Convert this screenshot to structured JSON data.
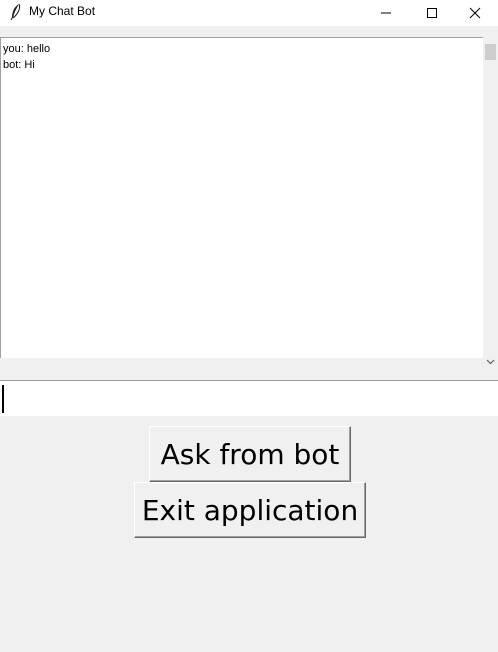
{
  "window": {
    "title": "My Chat Bot",
    "icon": "feather-icon",
    "controls": [
      "minimize-icon",
      "maximize-icon",
      "close-icon"
    ]
  },
  "chat": {
    "messages": [
      {
        "text": "you: hello"
      },
      {
        "text": "bot: Hi"
      }
    ]
  },
  "input": {
    "value": ""
  },
  "buttons": {
    "ask_label": "Ask from bot",
    "exit_label": "Exit application"
  }
}
